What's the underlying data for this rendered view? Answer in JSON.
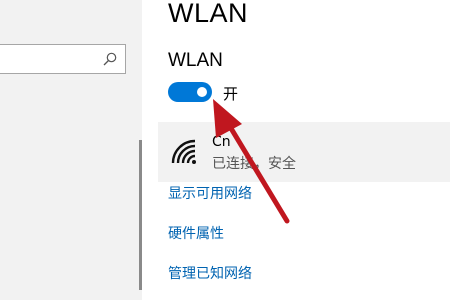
{
  "sidebar": {
    "search": {
      "placeholder": "",
      "icon": "search-icon"
    }
  },
  "page": {
    "title": "WLAN",
    "section_title": "WLAN",
    "toggle": {
      "state_label": "开",
      "on": true,
      "color": "#0078d7"
    }
  },
  "network": {
    "name": "Cn",
    "status": "已连接，安全",
    "icon": "wifi-signal-icon"
  },
  "links": {
    "show_available": "显示可用网络",
    "hardware_properties": "硬件属性",
    "manage_known": "管理已知网络"
  },
  "colors": {
    "accent": "#0078d7",
    "link": "#0063b1",
    "annotation": "#c0171f"
  }
}
